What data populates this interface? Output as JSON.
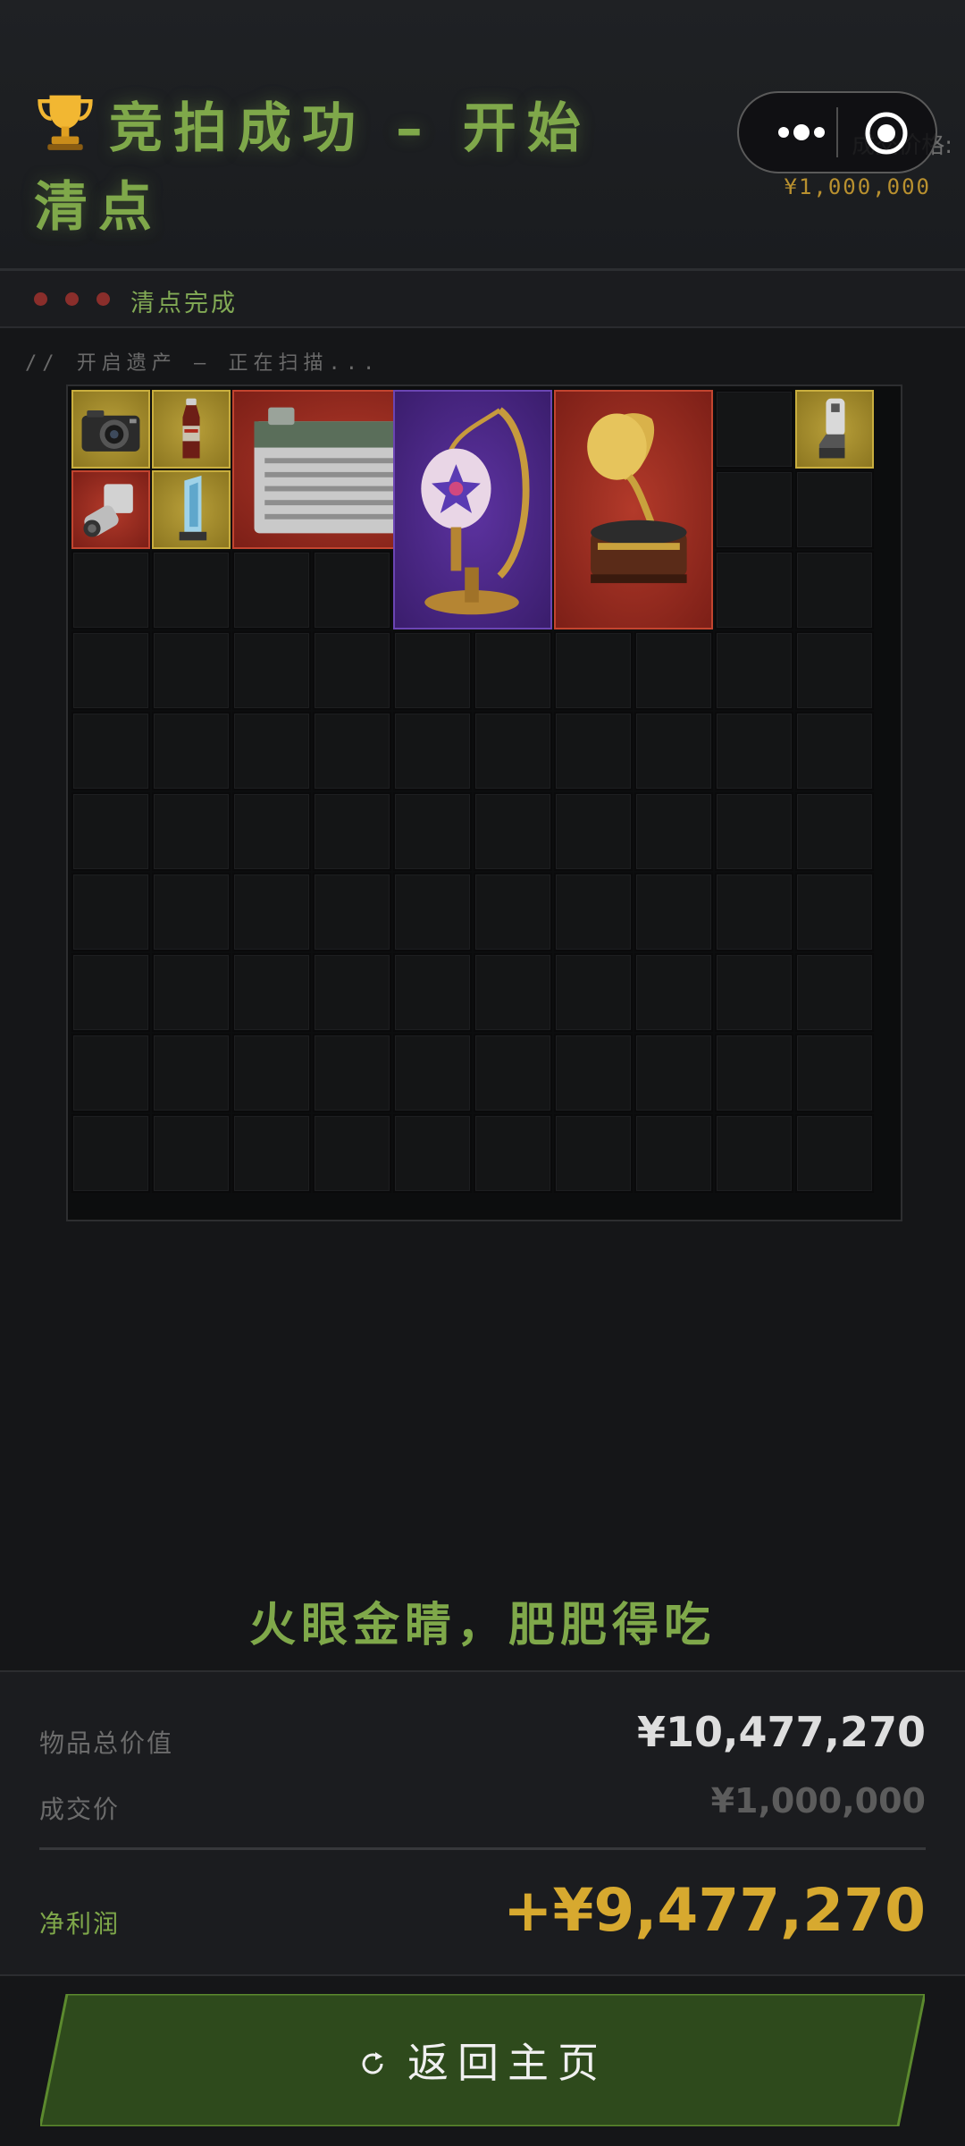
{
  "header": {
    "title": "竞拍成功 – 开始清点",
    "trophy_icon": "trophy-icon",
    "price_label": "成交价格:",
    "price_value": "¥1,000,000"
  },
  "capsule": {
    "more_icon": "more-icon",
    "close_icon": "target-icon"
  },
  "status": {
    "text": "清点完成",
    "dot_color": "#8a2e2b"
  },
  "scan_text": "// 开启遗产 – 正在扫描...",
  "grid": {
    "columns": 10,
    "rows": 10,
    "items": [
      {
        "name": "camera",
        "rarity": "yellow"
      },
      {
        "name": "soda-bottle",
        "rarity": "yellow"
      },
      {
        "name": "battery",
        "rarity": "red"
      },
      {
        "name": "moroccan-lamp",
        "rarity": "purple"
      },
      {
        "name": "gramophone",
        "rarity": "red"
      },
      {
        "name": "cable-adapter",
        "rarity": "yellow"
      },
      {
        "name": "projector-lens",
        "rarity": "red"
      },
      {
        "name": "crystal-trophy",
        "rarity": "yellow"
      }
    ]
  },
  "slogan": "火眼金睛，肥肥得吃",
  "summary": {
    "total_label": "物品总价值",
    "total_value": "¥10,477,270",
    "deal_label": "成交价",
    "deal_value": "¥1,000,000",
    "profit_label": "净利润",
    "profit_value": "+¥9,477,270"
  },
  "button": {
    "label": "返回主页",
    "icon": "refresh-icon"
  },
  "colors": {
    "accent_green": "#7fa84a",
    "gold": "#d7a92f",
    "rarity_yellow": "#b9a03a",
    "rarity_red": "#b33a2a",
    "rarity_purple": "#5d33a1"
  }
}
